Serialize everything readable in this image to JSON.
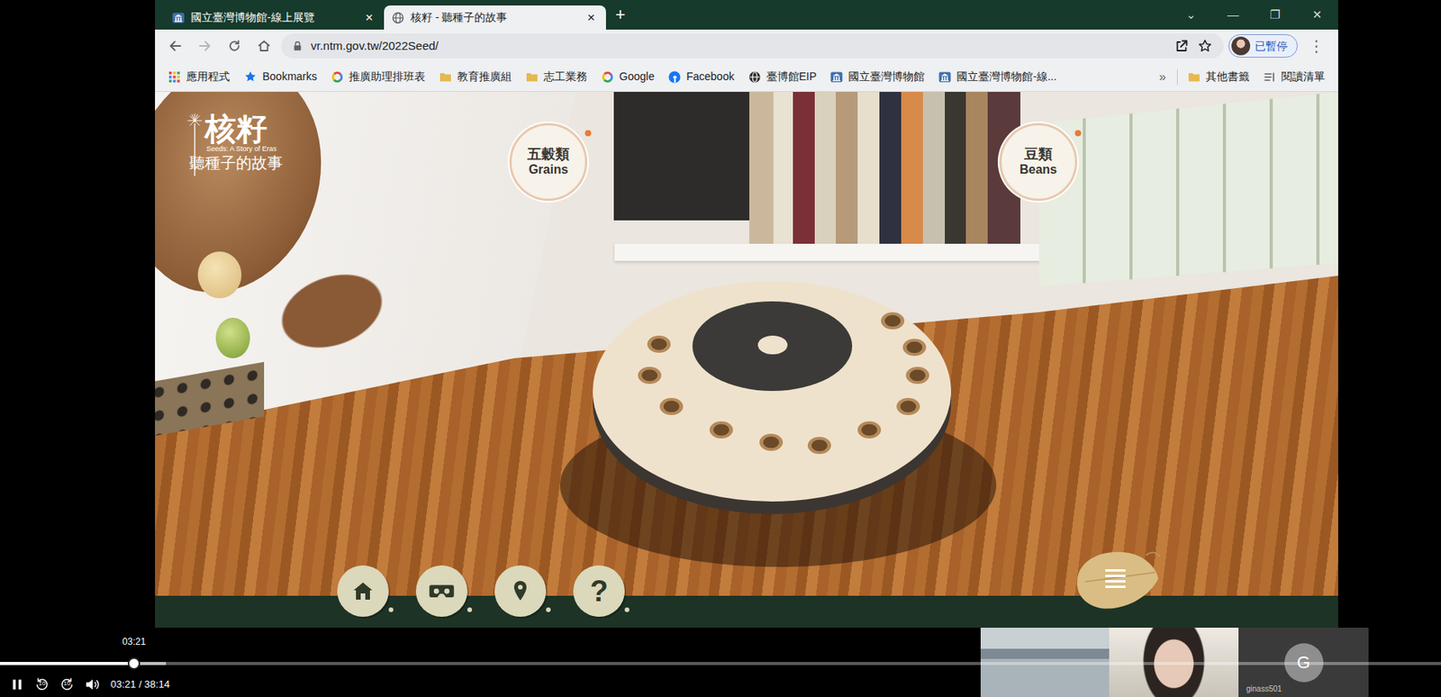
{
  "browser": {
    "tabs": [
      {
        "label": "國立臺灣博物館-線上展覽",
        "kind": "museum",
        "selected": false,
        "close": "×"
      },
      {
        "label": "核籽 - 聽種子的故事",
        "kind": "globe",
        "selected": true,
        "close": "×"
      }
    ],
    "new_tab": "+",
    "window_controls": [
      "⌄",
      "—",
      "❐",
      "✕"
    ],
    "nav": [
      {
        "kind": "back",
        "disabled": false
      },
      {
        "kind": "forward",
        "disabled": true
      },
      {
        "kind": "reload",
        "disabled": false
      },
      {
        "kind": "home",
        "disabled": false
      }
    ],
    "address": {
      "url": "vr.ntm.gov.tw/2022Seed/"
    },
    "profile": {
      "label": "已暫停"
    },
    "menu": "⋮",
    "bookmarks": [
      {
        "label": "應用程式",
        "kind": "apps"
      },
      {
        "label": "Bookmarks",
        "kind": "star"
      },
      {
        "label": "推廣助理排班表",
        "kind": "google"
      },
      {
        "label": "教育推廣組",
        "kind": "folder"
      },
      {
        "label": "志工業務",
        "kind": "folder"
      },
      {
        "label": "Google",
        "kind": "google"
      },
      {
        "label": "Facebook",
        "kind": "facebook"
      },
      {
        "label": "臺博館EIP",
        "kind": "globe"
      },
      {
        "label": "國立臺灣博物館",
        "kind": "museum"
      },
      {
        "label": "國立臺灣博物館-線...",
        "kind": "museum"
      }
    ],
    "bookmarks_more": "»",
    "bookmarks_right": [
      {
        "label": "其他書籤",
        "kind": "folder"
      },
      {
        "label": "閱讀清單",
        "kind": "reading"
      }
    ]
  },
  "exhibit": {
    "logo": {
      "title": "核籽",
      "subtitle": "Seeds: A Story of Eras",
      "tagline": "聽種子的故事"
    },
    "hotspots": [
      {
        "title": "五穀類",
        "subtitle": "Grains"
      },
      {
        "title": "豆類",
        "subtitle": "Beans"
      }
    ],
    "toolbar": [
      {
        "kind": "home"
      },
      {
        "kind": "vr"
      },
      {
        "kind": "location"
      },
      {
        "kind": "help",
        "glyph": "?"
      }
    ]
  },
  "player": {
    "playing": true,
    "tooltip": "03:21",
    "level": 0.093,
    "buffered": 0.115,
    "time": "03:21 / 38:14",
    "skip_back": "10",
    "skip_forward": "10"
  },
  "participants": {
    "avatar": "G",
    "name": "ginass501"
  }
}
